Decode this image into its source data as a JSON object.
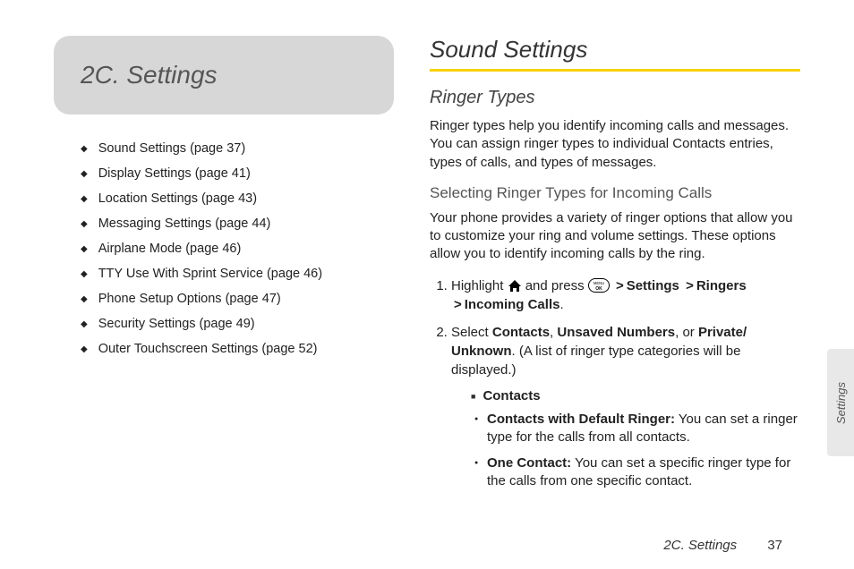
{
  "chapter": {
    "title": "2C. Settings"
  },
  "toc": [
    "Sound Settings (page 37)",
    "Display Settings (page 41)",
    "Location Settings (page 43)",
    "Messaging Settings (page 44)",
    "Airplane Mode (page 46)",
    "TTY Use With Sprint Service (page 46)",
    "Phone Setup Options (page 47)",
    "Security Settings (page 49)",
    "Outer Touchscreen Settings (page 52)"
  ],
  "section": {
    "title": "Sound Settings",
    "subsection_title": "Ringer Types",
    "intro": "Ringer types help you identify incoming calls and messages. You can assign ringer types to individual Contacts entries, types of calls, and types of messages.",
    "subsub_title": "Selecting Ringer Types for Incoming Calls",
    "subsub_intro": "Your phone provides a variety of ringer options that allow you to customize your ring and volume settings. These options allow you to identify incoming calls by the ring.",
    "step1_prefix": "Highlight ",
    "step1_mid": " and press ",
    "step1_path": [
      "Settings",
      "Ringers",
      "Incoming Calls"
    ],
    "step2_a": "Select ",
    "step2_b1": "Contacts",
    "step2_b2": "Unsaved Numbers",
    "step2_b3": "Private/ Unknown",
    "step2_c": ". (A list of ringer type categories will be displayed.)",
    "contacts_label": "Contacts",
    "bullet1_strong": "Contacts with Default Ringer:",
    "bullet1_text": " You can set a ringer type for the calls from all contacts.",
    "bullet2_strong": "One Contact:",
    "bullet2_text": " You can set a specific ringer type for the calls from one specific contact."
  },
  "side_tab": "Settings",
  "footer": {
    "chapter": "2C. Settings",
    "page": "37"
  }
}
